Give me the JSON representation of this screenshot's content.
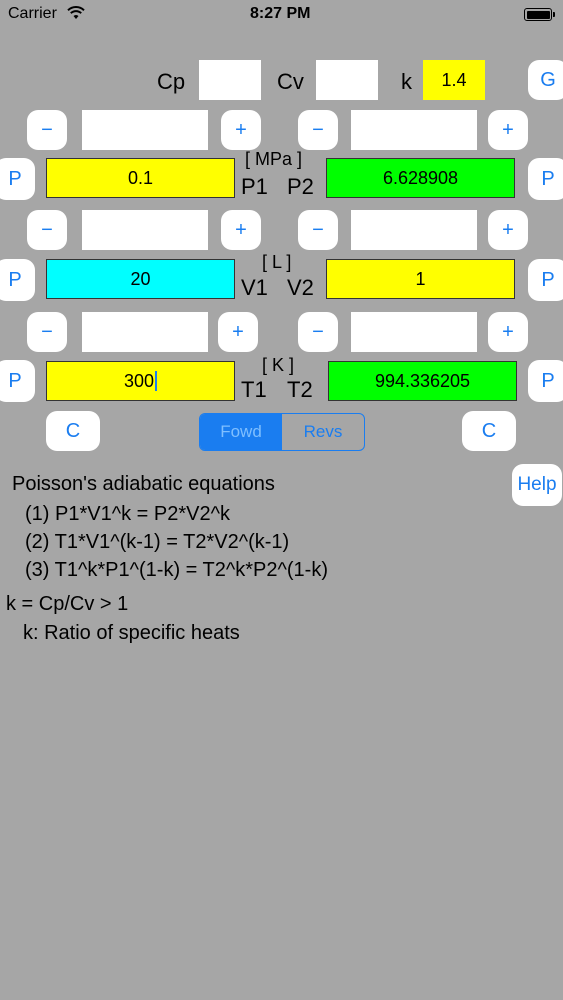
{
  "status_bar": {
    "carrier": "Carrier",
    "time": "8:27 PM"
  },
  "constants": {
    "cp_label": "Cp",
    "cp_value": "",
    "cv_label": "Cv",
    "cv_value": "",
    "k_label": "k",
    "k_value": "1.4",
    "g_button": "G"
  },
  "buttons": {
    "minus": "−",
    "plus": "+",
    "p": "P",
    "c": "C",
    "help": "Help"
  },
  "pressure": {
    "unit": "[ MPa ]",
    "p1_label": "P1",
    "p2_label": "P2",
    "p1_value": "0.1",
    "p2_value": "6.628908",
    "step1": "",
    "step2": ""
  },
  "volume": {
    "unit": "[ L ]",
    "v1_label": "V1",
    "v2_label": "V2",
    "v1_value": "20",
    "v2_value": "1",
    "step1": "",
    "step2": ""
  },
  "temperature": {
    "unit": "[ K ]",
    "t1_label": "T1",
    "t2_label": "T2",
    "t1_value": "300",
    "t2_value": "994.336205",
    "step1": "",
    "step2": ""
  },
  "segment": {
    "fowd": "Fowd",
    "revs": "Revs",
    "selected": "Fowd"
  },
  "info": {
    "heading": "Poisson's adiabatic equations",
    "eq1": "(1) P1*V1^k = P2*V2^k",
    "eq2": "(2) T1*V1^(k-1) = T2*V2^(k-1)",
    "eq3": "(3) T1^k*P1^(1-k) = T2^k*P2^(1-k)",
    "k_def": "k = Cp/Cv > 1",
    "k_desc": "k: Ratio of specific heats"
  },
  "colors": {
    "accent": "#1a7df0",
    "background": "#a6a6a6",
    "yellow": "#ffff00",
    "green": "#00ff00",
    "cyan": "#00ffff"
  }
}
